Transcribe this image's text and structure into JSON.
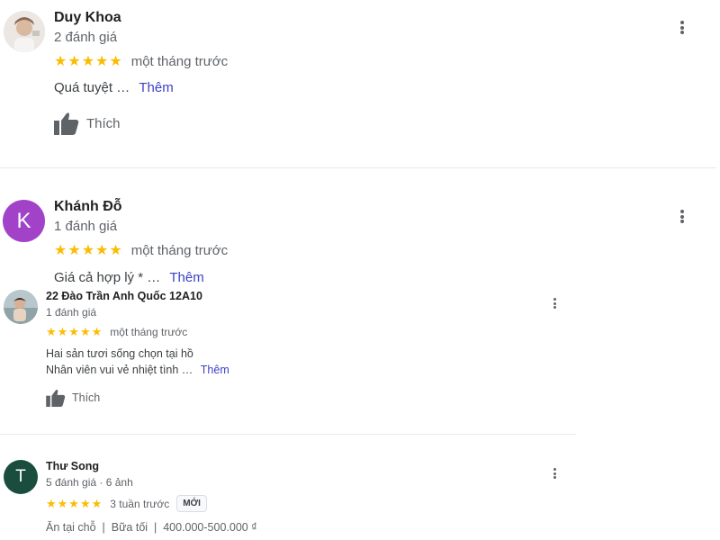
{
  "reviews": [
    {
      "name": "Duy Khoa",
      "meta": "2 đánh giá",
      "stars": "★★★★★",
      "time": "một tháng trước",
      "text": "Quá tuyệt …",
      "more": "Thêm",
      "like": "Thích"
    },
    {
      "name": "Khánh Đỗ",
      "avatar_letter": "K",
      "meta": "1 đánh giá",
      "stars": "★★★★★",
      "time": "một tháng trước",
      "text": "Giá cả hợp lý * …",
      "more": "Thêm"
    },
    {
      "name": "22 Đào Trần Anh Quốc 12A10",
      "meta": "1 đánh giá",
      "stars": "★★★★★",
      "time": "một tháng trước",
      "text_line1": "Hai sản tươi sống chọn tại hồ",
      "text_line2": "Nhân viên vui vẻ nhiệt tình …",
      "more": "Thêm",
      "like": "Thích"
    },
    {
      "name": "Thư Song",
      "avatar_letter": "T",
      "meta": "5 đánh giá · 6 ảnh",
      "stars": "★★★★★",
      "time": "3 tuần trước",
      "badge": "MỚI",
      "details": "Ăn tại chỗ  |  Bữa tối  |  400.000-500.000 ₫"
    }
  ],
  "colors": {
    "star": "#fbbc04",
    "avatar_k": "#a142c9",
    "avatar_t": "#1b4d3e",
    "link": "#3b42c4"
  }
}
